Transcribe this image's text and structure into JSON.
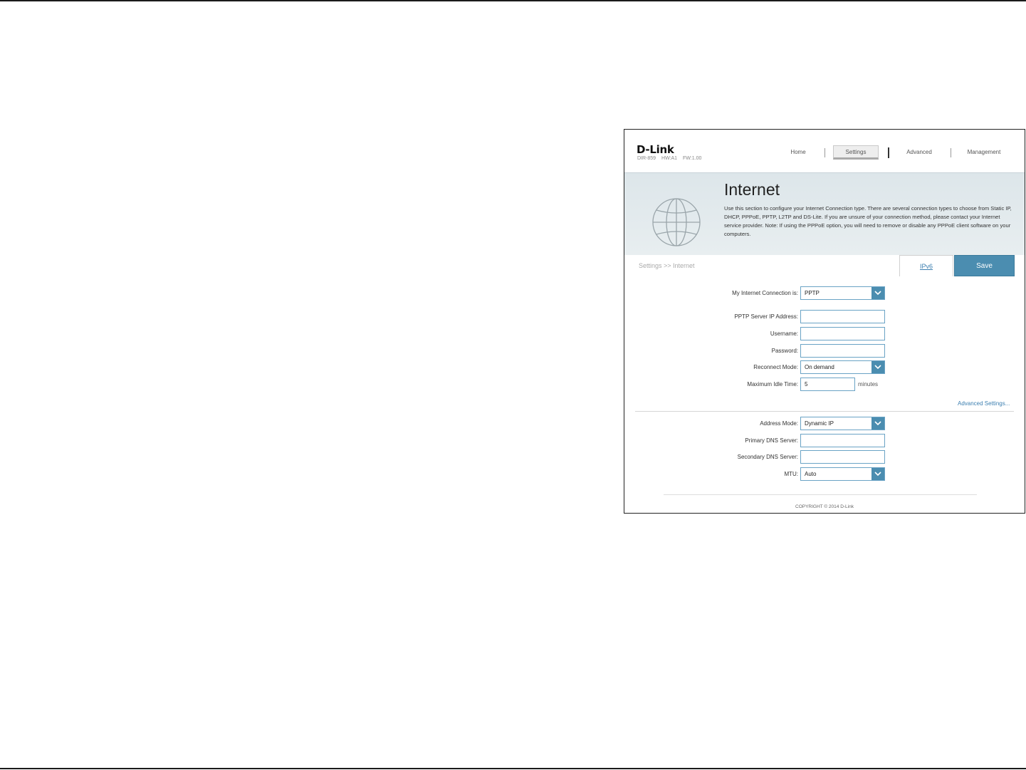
{
  "header": {
    "logo": "D-Link",
    "model": "DIR-859",
    "hw": "HW:A1",
    "fw": "FW:1.00",
    "nav": {
      "home": "Home",
      "settings": "Settings",
      "advanced": "Advanced",
      "management": "Management"
    }
  },
  "banner": {
    "title": "Internet",
    "description": "Use this section to configure your Internet Connection type. There are several connection types to choose from Static IP, DHCP, PPPoE, PPTP, L2TP and DS-Lite. If you are unsure of your connection method, please contact your Internet service provider. Note: If using the PPPoE option, you will need to remove or disable any PPPoE client software on your computers."
  },
  "toolbar": {
    "breadcrumb": "Settings >> Internet",
    "ipv6_label": "IPv6",
    "save_label": "Save"
  },
  "form": {
    "connection": {
      "label": "My Internet Connection is:",
      "value": "PPTP"
    },
    "server_ip": {
      "label": "PPTP Server IP Address:",
      "value": ""
    },
    "username": {
      "label": "Username:",
      "value": ""
    },
    "password": {
      "label": "Password:",
      "value": ""
    },
    "reconnect": {
      "label": "Reconnect Mode:",
      "value": "On demand"
    },
    "idle": {
      "label": "Maximum Idle Time:",
      "value": "5",
      "unit": "minutes"
    },
    "advanced_link": "Advanced Settings...",
    "address_mode": {
      "label": "Address Mode:",
      "value": "Dynamic IP"
    },
    "primary_dns": {
      "label": "Primary DNS Server:",
      "value": ""
    },
    "secondary_dns": {
      "label": "Secondary DNS Server:",
      "value": ""
    },
    "mtu": {
      "label": "MTU:",
      "value": "Auto"
    }
  },
  "footer": {
    "copyright": "COPYRIGHT © 2014 D-Link"
  },
  "colors": {
    "accent": "#4b8db0",
    "link": "#3c7fb0",
    "input_border": "#6aa3c5"
  }
}
